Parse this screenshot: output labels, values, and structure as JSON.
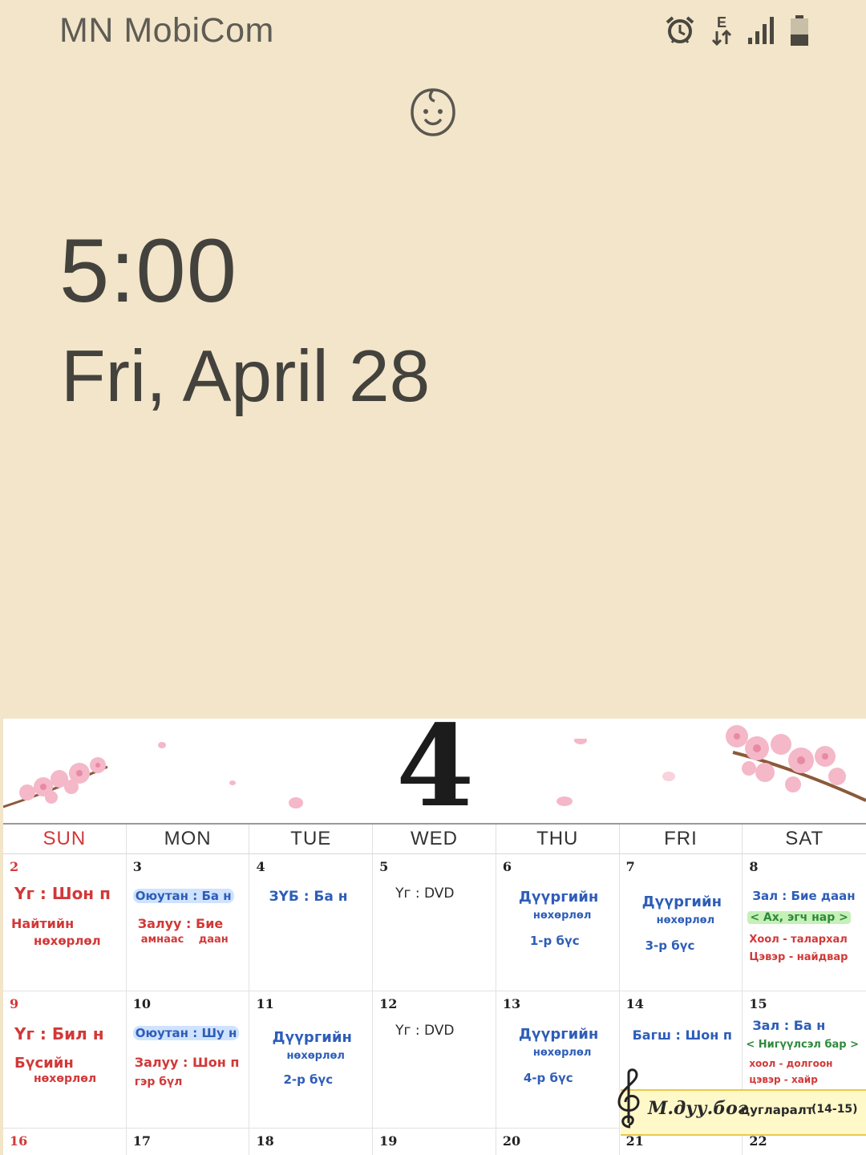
{
  "status_bar": {
    "carrier": "MN MobiCom",
    "icons": [
      "alarm-icon",
      "data-e-icon",
      "signal-icon",
      "battery-icon"
    ],
    "network_type": "E"
  },
  "lockscreen": {
    "profile_icon": "baby-face-icon",
    "time": "5:00",
    "date": "Fri, April 28"
  },
  "wallpaper": {
    "month": "4",
    "weekdays": [
      "SUN",
      "MON",
      "TUE",
      "WED",
      "THU",
      "FRI",
      "SAT"
    ],
    "weeks": [
      {
        "days": [
          {
            "num": "2",
            "lines": [
              "Үг : Шон п",
              "Найтийн",
              "нөхөрлөл"
            ]
          },
          {
            "num": "3",
            "lines": [
              "Оюутан : Ба н",
              "Залуу : Бие",
              "амнаас",
              "даан"
            ]
          },
          {
            "num": "4",
            "lines": [
              "ЗҮБ : Ба н"
            ]
          },
          {
            "num": "5",
            "lines": [
              "Үг : DVD"
            ]
          },
          {
            "num": "6",
            "lines": [
              "Дүүргийн",
              "нөхөрлөл",
              "1-р бүс"
            ]
          },
          {
            "num": "7",
            "lines": [
              "Дүүргийн",
              "нөхөрлөл",
              "3-р бүс"
            ]
          },
          {
            "num": "8",
            "lines": [
              "Зал : Бие даан",
              "< Ах, эгч нар >",
              "Хоол - талархал",
              "Цэвэр - найдвар"
            ]
          }
        ]
      },
      {
        "days": [
          {
            "num": "9",
            "lines": [
              "Үг : Бил н",
              "Бүсийн",
              "нөхөрлөл"
            ]
          },
          {
            "num": "10",
            "lines": [
              "Оюутан : Шу н",
              "Залуу : Шон п",
              "гэр бүл"
            ]
          },
          {
            "num": "11",
            "lines": [
              "Дүүргийн",
              "нөхөрлөл",
              "2-р бүс"
            ]
          },
          {
            "num": "12",
            "lines": [
              "Үг : DVD"
            ]
          },
          {
            "num": "13",
            "lines": [
              "Дүүргийн",
              "нөхөрлөл",
              "4-р бүс"
            ]
          },
          {
            "num": "14",
            "lines": [
              "Багш : Шон п"
            ]
          },
          {
            "num": "15",
            "lines": [
              "Зал : Ба н",
              "< Нигүүлсэл бар >",
              "хоол - долгоон",
              "цэвэр - хайр"
            ]
          }
        ]
      },
      {
        "days": [
          {
            "num": "16"
          },
          {
            "num": "17"
          },
          {
            "num": "18"
          },
          {
            "num": "19"
          },
          {
            "num": "20"
          },
          {
            "num": "21"
          },
          {
            "num": "22"
          }
        ]
      }
    ],
    "banner": {
      "title": "М.дуу.бог",
      "subtitle": "цугларалт",
      "range": "(14-15)"
    }
  },
  "colors": {
    "background": "#f2e5c9",
    "text": "#44423d",
    "sunday": "#d23838",
    "accent_blue": "#2e5db8"
  }
}
